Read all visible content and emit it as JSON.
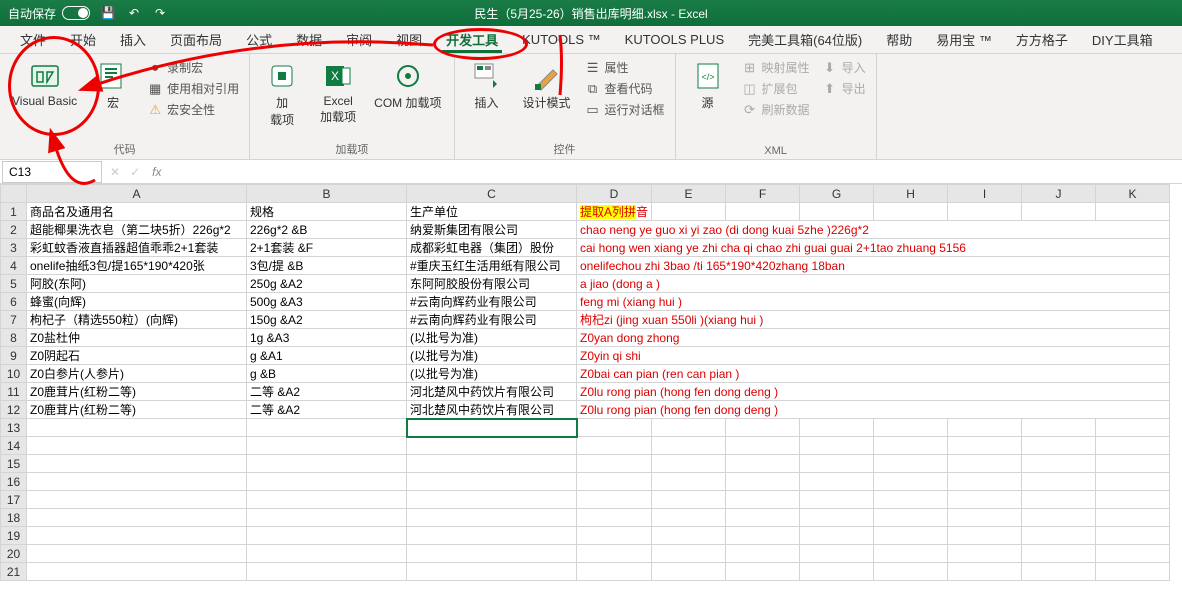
{
  "titlebar": {
    "autosave_label": "自动保存",
    "title": "民生（5月25-26）销售出库明细.xlsx  -  Excel"
  },
  "tabs": [
    "文件",
    "开始",
    "插入",
    "页面布局",
    "公式",
    "数据",
    "审阅",
    "视图",
    "开发工具",
    "KUTOOLS ™",
    "KUTOOLS PLUS",
    "完美工具箱(64位版)",
    "帮助",
    "易用宝 ™",
    "方方格子",
    "DIY工具箱"
  ],
  "active_tab": 8,
  "ribbon": {
    "g1": {
      "label": "代码",
      "vb": "Visual Basic",
      "macro": "宏",
      "record": "录制宏",
      "relref": "使用相对引用",
      "security": "宏安全性"
    },
    "g2": {
      "label": "加载项",
      "addins": "加\n载项",
      "excel_addins": "Excel\n加载项",
      "com": "COM 加载项"
    },
    "g3": {
      "label": "控件",
      "insert": "插入",
      "design": "设计模式",
      "props": "属性",
      "viewcode": "查看代码",
      "rundlg": "运行对话框"
    },
    "g4": {
      "label": "XML",
      "source": "源",
      "mapprop": "映射属性",
      "extpack": "扩展包",
      "refresh": "刷新数据",
      "import": "导入",
      "export": "导出"
    }
  },
  "namebox": "C13",
  "chart_data": {
    "type": "table",
    "headers": [
      "商品名及通用名",
      "规格",
      "生产单位",
      "提取A列拼音"
    ],
    "rows": [
      [
        "超能椰果洗衣皂（第二块5折）226g*2",
        "226g*2  &B",
        "纳爱斯集团有限公司",
        "chao neng ye guo xi yi zao (di dong kuai 5zhe )226g*2"
      ],
      [
        "彩虹蚊香液直插器超值乖乖2+1套装",
        "2+1套装  &F",
        "成都彩虹电器（集团）股份",
        "cai hong wen xiang ye zhi cha qi chao zhi guai guai 2+1tao zhuang 5156"
      ],
      [
        "onelife抽纸3包/提165*190*420张",
        "3包/提  &B",
        "#重庆玉红生活用纸有限公司",
        "onelifechou zhi 3bao /ti 165*190*420zhang 18ban"
      ],
      [
        "阿胶(东阿)",
        "250g  &A2",
        "东阿阿胶股份有限公司",
        "a jiao (dong a )"
      ],
      [
        "蜂蜜(向辉)",
        "500g  &A3",
        "#云南向辉药业有限公司",
        "feng mi (xiang hui )"
      ],
      [
        "枸杞子（精选550粒）(向辉)",
        "150g  &A2",
        "#云南向辉药业有限公司",
        "枸杞zi (jing xuan 550li )(xiang hui )"
      ],
      [
        "Z0盐杜仲",
        "1g  &A3",
        "(以批号为准)",
        "Z0yan dong zhong"
      ],
      [
        "Z0阴起石",
        "g  &A1",
        "(以批号为准)",
        "Z0yin qi shi"
      ],
      [
        "Z0白参片(人参片)",
        "g  &B",
        "(以批号为准)",
        "Z0bai can pian (ren can pian )"
      ],
      [
        "Z0鹿茸片(红粉二等)",
        "二等  &A2",
        "河北楚风中药饮片有限公司",
        "Z0lu rong pian (hong fen dong deng )"
      ],
      [
        "Z0鹿茸片(红粉二等)",
        "二等  &A2",
        "河北楚风中药饮片有限公司",
        "Z0lu rong pian (hong fen dong deng )"
      ]
    ]
  }
}
